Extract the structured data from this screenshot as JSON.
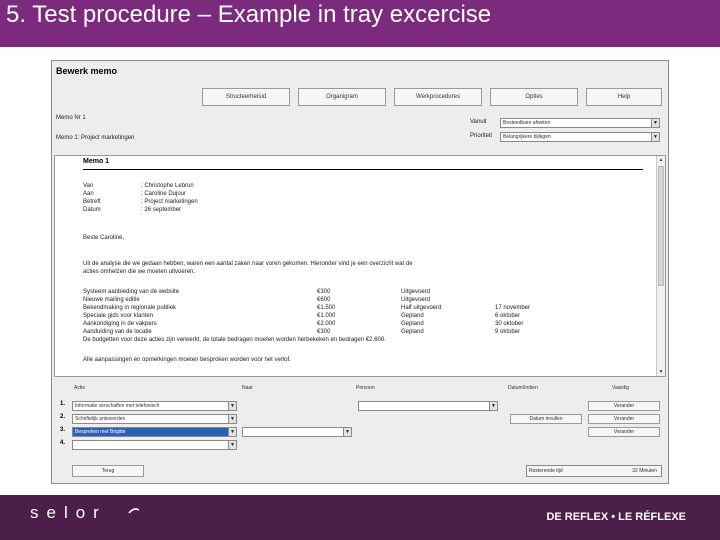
{
  "slide": {
    "title": "5. Test procedure – Example in tray excercise"
  },
  "app": {
    "title": "Bewerk memo",
    "toolbar": [
      {
        "label": "Structeerhetsid"
      },
      {
        "label": "Organigram"
      },
      {
        "label": "Werkprocedures"
      },
      {
        "label": "Opties"
      },
      {
        "label": "Help"
      }
    ],
    "meta": {
      "memo_id": "Memo Nr 1",
      "memo_subject": "Memo 1: Project marketingen",
      "field1_label": "Vanuit",
      "field1_value": "Besteedbare afweten",
      "field2_label": "Prioriteit",
      "field2_value": "Belangrijkere bijlagen"
    }
  },
  "memo": {
    "heading": "Memo 1",
    "header_lines": [
      {
        "label": "Van",
        "value": ": Christophe Lebrun"
      },
      {
        "label": "Aan",
        "value": ": Caroline Dujour"
      },
      {
        "label": "Betreft",
        "value": ": Project marketingen"
      },
      {
        "label": "Datum",
        "value": ": 26 september"
      }
    ],
    "greeting": "Beste Caroline,",
    "intro": [
      "Uit de analyse die we gedaan hebben, waren een aantal zaken naar voren gekomen. Hieronder vind je een overzicht wat de",
      "acties omhelzen die we moeten uitvoeren."
    ],
    "table": [
      {
        "task": "Systeem aanbieding van de website",
        "amount": "€300",
        "status": "Uitgevoerd",
        "date": ""
      },
      {
        "task": "Nieuwe mailing editie",
        "amount": "€600",
        "status": "Uitgevoerd",
        "date": ""
      },
      {
        "task": "Bekendmaking in regionale publiek",
        "amount": "€1.500",
        "status": "Half uitgevoerd",
        "date": "17 november"
      },
      {
        "task": "Speciale gids voor klanten",
        "amount": "€1.000",
        "status": "Gepland",
        "date": "6 oktober"
      },
      {
        "task": "Aankondiging in de vakpers",
        "amount": "€2.000",
        "status": "Gepland",
        "date": "30 oktober"
      },
      {
        "task": "Aanduiding van de locatie",
        "amount": "€300",
        "status": "Gepland",
        "date": "9 oktober"
      }
    ],
    "after_table": [
      "De budgetten voor deze acties zijn verwerkt, de totale bedragen moeten worden herbekeken en bedragen €2.600.",
      "Alle aanpassingen en opmerkingen moeten besproken worden voor het verlof."
    ]
  },
  "actions": {
    "headers": [
      "Actie",
      "Naar",
      "Persoon",
      "Datum/Indien",
      "Vaardig"
    ],
    "rows": [
      {
        "num": "1.",
        "action": "Informatie verschaffen met telefonisch",
        "naar": "",
        "persoon": "",
        "datum_btn": "",
        "vaardig_btn": "Verander"
      },
      {
        "num": "2.",
        "action": "Schriftelijk antwoorden",
        "naar": "",
        "persoon": "",
        "datum_btn": "Datum invullen",
        "vaardig_btn": "Verander"
      },
      {
        "num": "3.",
        "action": "Bespreken met Brigitte",
        "naar": "",
        "persoon": "",
        "datum_btn": "",
        "vaardig_btn": "Verander"
      },
      {
        "num": "4.",
        "action": "",
        "naar": "",
        "persoon": "",
        "datum_btn": "",
        "vaardig_btn": ""
      }
    ]
  },
  "footer": {
    "back_label": "Terug",
    "time_label": "Resterende tijd",
    "time_value": "32 Minuten"
  },
  "branding": {
    "logo": "selor",
    "tagline": "DE REFLEX • LE RÉFLEXE"
  },
  "colors": {
    "title_bar": "#7b2a7e",
    "bottom_bar": "#4b1f4a",
    "selection": "#2a5fb6"
  }
}
